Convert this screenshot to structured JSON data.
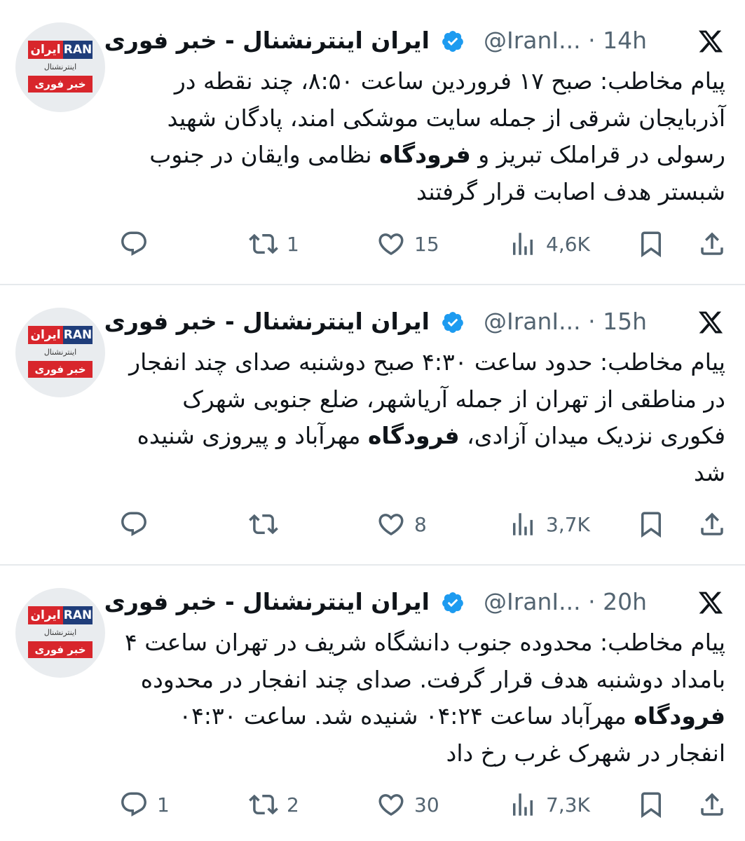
{
  "avatar_logo": {
    "red": "ایران",
    "blue": "RAN",
    "mid": "اینترنشنال",
    "bottom": "خبر فوری"
  },
  "tweets": [
    {
      "name": "ایران اینترنشنال - خبر فوری",
      "handle": "@IranI...",
      "time": "14h",
      "text_parts": [
        {
          "t": "پیام مخاطب: صبح ۱۷ فروردین ساعت ۸:۵۰، چند نقطه در آذربایجان شرقی از جمله سایت موشکی امند، پادگان شهید رسولی در قراملک تبریز و "
        },
        {
          "t": "فرودگاه",
          "bold": true
        },
        {
          "t": " نظامی وایقان در جنوب شبستر هدف اصابت قرار گرفتند"
        }
      ],
      "replies": "",
      "reposts": "1",
      "likes": "15",
      "views": "4,6K"
    },
    {
      "name": "ایران اینترنشنال - خبر فوری",
      "handle": "@IranI...",
      "time": "15h",
      "text_parts": [
        {
          "t": "پیام مخاطب: حدود ساعت ۴:۳۰ صبح دوشنبه صدای چند انفجار در مناطقی از تهران از جمله آریاشهر، ضلع جنوبی شهرک فکوری نزدیک میدان آزادی، "
        },
        {
          "t": "فرودگاه",
          "bold": true
        },
        {
          "t": " مهرآباد و پیروزی شنیده شد"
        }
      ],
      "replies": "",
      "reposts": "",
      "likes": "8",
      "views": "3,7K"
    },
    {
      "name": "ایران اینترنشنال - خبر فوری",
      "handle": "@IranI...",
      "time": "20h",
      "text_parts": [
        {
          "t": "پیام مخاطب: محدوده جنوب دانشگاه شریف در تهران ساعت ۴ بامداد دوشنبه هدف قرار گرفت. صدای چند انفجار در محدوده "
        },
        {
          "t": "فرودگاه",
          "bold": true
        },
        {
          "t": " مهرآباد ساعت ۰۴:۲۴ شنیده شد. ساعت ۰۴:۳۰ انفجار در شهرک غرب رخ داد"
        }
      ],
      "replies": "1",
      "reposts": "2",
      "likes": "30",
      "views": "7,3K"
    }
  ],
  "colors": {
    "accent": "#1d9bf0",
    "muted": "#536471",
    "brand_red": "#d8262c",
    "brand_blue": "#1f3d7a"
  }
}
